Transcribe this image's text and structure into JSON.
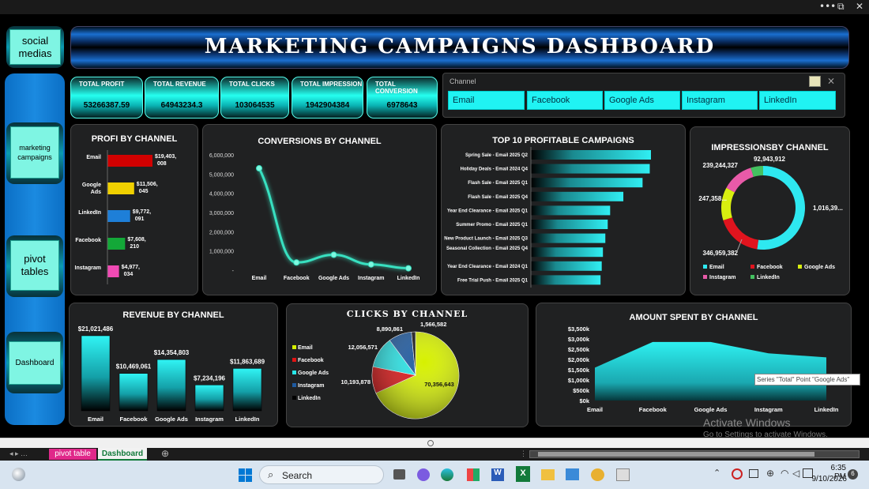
{
  "window": {
    "more": "•••",
    "restore": "⧉",
    "close": "✕"
  },
  "nav": {
    "social": "social\nmedias",
    "marketing": "marketing\ncampaigns",
    "pivot": "pivot\ntables",
    "dashboard": "Dashboard"
  },
  "banner": {
    "title": "MARKETING CAMPAIGNS DASHBOARD"
  },
  "kpis": [
    {
      "label": "TOTAL PROFIT",
      "value": "53266387.59"
    },
    {
      "label": "TOTAL REVENUE",
      "value": "64943234.3"
    },
    {
      "label": "TOTAL CLICKS",
      "value": "103064535"
    },
    {
      "label": "TOTAL IMPRESSION",
      "value": "1942904384"
    },
    {
      "label": "TOTAL CONVERSION",
      "value": "6978643"
    }
  ],
  "slicer": {
    "title": "Channel",
    "items": [
      "Email",
      "Facebook",
      "Google Ads",
      "Instagram",
      "LinkedIn"
    ]
  },
  "chart_data": [
    {
      "type": "bar",
      "title": "PROFI BY CHANNEL",
      "categories": [
        "Email",
        "Google Ads",
        "LinkedIn",
        "Facebook",
        "Instagram"
      ],
      "values": [
        19403008,
        11506045,
        9772091,
        7608210,
        4977034
      ],
      "labels": [
        "$19,403,008",
        "$11,506,045",
        "$9,772,091",
        "$7,608,210",
        "$4,977,034"
      ],
      "colors": [
        "#d10000",
        "#f0d000",
        "#1e7fd8",
        "#13a838",
        "#f04ab4"
      ]
    },
    {
      "type": "line",
      "title": "CONVERSIONS BY CHANNEL",
      "categories": [
        "Email",
        "Facebook",
        "Google Ads",
        "Instagram",
        "LinkedIn"
      ],
      "values": [
        5300000,
        400000,
        800000,
        300000,
        100000
      ],
      "yticks": [
        "6,000,000",
        "5,000,000",
        "4,000,000",
        "3,000,000",
        "2,000,000",
        "1,000,000",
        "-"
      ],
      "ylim": [
        0,
        6000000
      ],
      "color": "#38e0c0"
    },
    {
      "type": "bar",
      "title": "TOP 10 PROFITABLE CAMPAIGNS",
      "categories": [
        "Spring Sale - Email 2025 Q2",
        "Holiday Deals - Email 2024 Q4",
        "Flash Sale - Email 2025 Q1",
        "Flash Sale - Email 2025 Q4",
        "Year End Clearance - Email 2025 Q1",
        "Summer Promo - Email 2025 Q1",
        "New Product Launch - Email 2025 Q3",
        "Seasonal Collection - Email 2025 Q4",
        "Year End Clearance - Email 2024 Q1",
        "Free Trial Push - Email 2025 Q1"
      ],
      "values": [
        100,
        99,
        93,
        77,
        66,
        64,
        62,
        60,
        59,
        58
      ],
      "color": "#30ecf0"
    },
    {
      "type": "pie",
      "title": "IMPRESSIONSBY CHANNEL",
      "categories": [
        "Email",
        "Facebook",
        "Google Ads",
        "Instagram",
        "LinkedIn"
      ],
      "values": [
        1016390000,
        346959382,
        247358000,
        239244327,
        92943912
      ],
      "labels": [
        "1,016,39...",
        "346,959,382",
        "247,358...",
        "239,244,327",
        "92,943,912"
      ],
      "colors": [
        "#2ee8f0",
        "#e0141e",
        "#d8ee10",
        "#e85aa8",
        "#44c060"
      ]
    },
    {
      "type": "bar",
      "title": "REVENUE BY CHANNEL",
      "categories": [
        "Email",
        "Facebook",
        "Google Ads",
        "Instagram",
        "LinkedIn"
      ],
      "values": [
        21021486,
        10469061,
        14354803,
        7234196,
        11863689
      ],
      "labels": [
        "$21,021,486",
        "$10,469,061",
        "$14,354,803",
        "$7,234,196",
        "$11,863,689"
      ],
      "color": "#30f0f0"
    },
    {
      "type": "pie",
      "title": "CLICKS BY CHANNEL",
      "categories": [
        "Email",
        "Facebook",
        "Google Ads",
        "Instagram",
        "LinkedIn"
      ],
      "values": [
        70356643,
        10193878,
        12056571,
        8890861,
        1566582
      ],
      "labels": [
        "70,356,643",
        "10,193,878",
        "12,056,571",
        "8,890,861",
        "1,566,582"
      ],
      "colors": [
        "#d6f000",
        "#e01414",
        "#28e6e8",
        "#1e5aa0",
        "#111111"
      ]
    },
    {
      "type": "area",
      "title": "AMOUNT SPENT BY CHANNEL",
      "categories": [
        "Email",
        "Facebook",
        "Google Ads",
        "Instagram",
        "LinkedIn"
      ],
      "values": [
        1600000,
        2850000,
        2850000,
        2300000,
        2100000
      ],
      "yticks": [
        "$3,500k",
        "$3,000k",
        "$2,500k",
        "$2,000k",
        "$1,500k",
        "$1,000k",
        "$500k",
        "$0k"
      ],
      "ylim": [
        0,
        3500000
      ],
      "color": "#2ef0f0",
      "tooltip": "Series \"Total\" Point \"Google Ads\""
    }
  ],
  "watermark": {
    "line1": "Activate Windows",
    "line2": "Go to Settings to activate Windows."
  },
  "sheets": {
    "nav": "◂  ▸  …",
    "tab1": "pivot table",
    "tab2": "Dashboard",
    "add": "⊕"
  },
  "taskbar": {
    "search": "Search",
    "time": "6:35 PM",
    "date": "9/10/2026",
    "badge": "6"
  }
}
